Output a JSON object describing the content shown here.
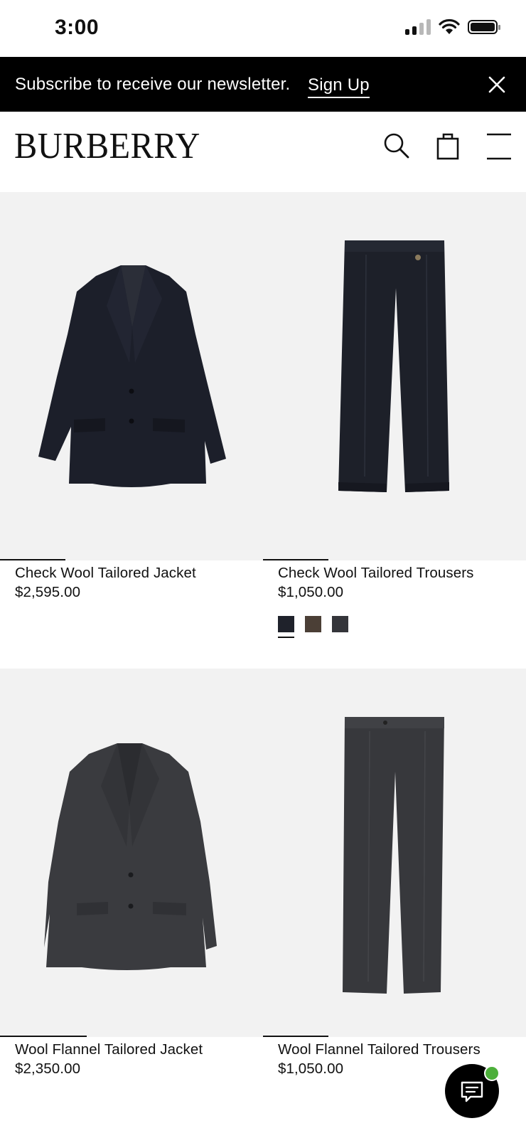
{
  "status_bar": {
    "time": "3:00"
  },
  "banner": {
    "text": "Subscribe to receive our newsletter.",
    "link": "Sign Up"
  },
  "header": {
    "logo": "BURBERRY"
  },
  "products": [
    {
      "name": "Check Wool Tailored Jacket",
      "price": "$2,595.00"
    },
    {
      "name": "Check Wool Tailored Trousers",
      "price": "$1,050.00",
      "swatches": [
        {
          "color": "#1f222b",
          "selected": true
        },
        {
          "color": "#4b3f36",
          "selected": false
        },
        {
          "color": "#34353a",
          "selected": false
        }
      ]
    },
    {
      "name": "Wool Flannel Tailored Jacket",
      "price": "$2,350.00"
    },
    {
      "name": "Wool Flannel Tailored Trousers",
      "price": "$1,050.00"
    }
  ],
  "colors": {
    "banner_bg": "#000000",
    "chat_status": "#4caf3a",
    "image_bg": "#f2f2f2"
  }
}
